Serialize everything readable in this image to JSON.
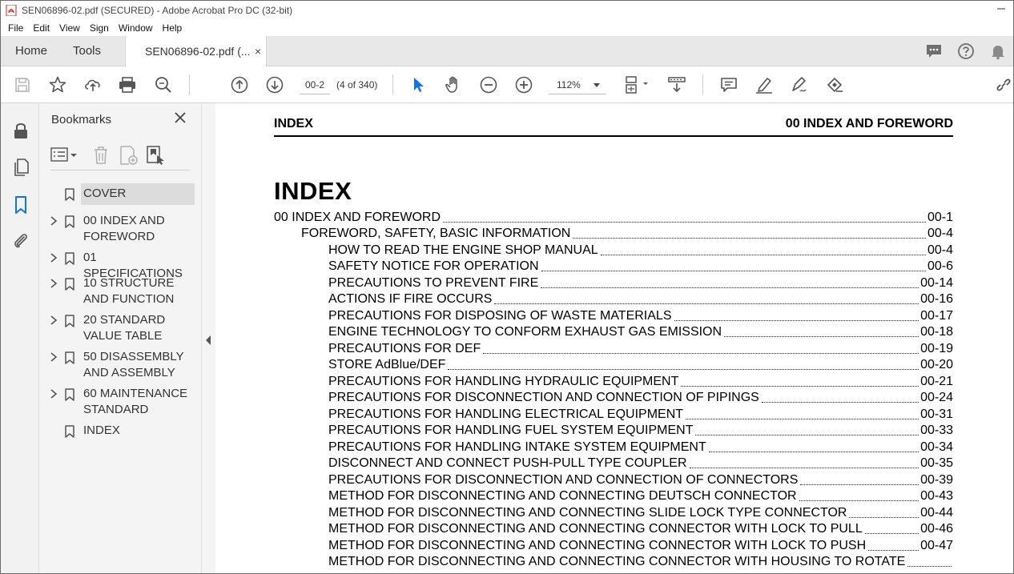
{
  "window": {
    "title": "SEN06896-02.pdf (SECURED) - Adobe Acrobat Pro DC (32-bit)"
  },
  "menu": [
    "File",
    "Edit",
    "View",
    "Sign",
    "Window",
    "Help"
  ],
  "tabs": {
    "home": "Home",
    "tools": "Tools",
    "document": "SEN06896-02.pdf (...",
    "close": "×"
  },
  "toolbar": {
    "page_value": "00-2",
    "page_count": "(4 of 340)",
    "zoom": "112%"
  },
  "bookmarks": {
    "title": "Bookmarks",
    "items": [
      {
        "label": "COVER",
        "expandable": false,
        "selected": true
      },
      {
        "label": "00 INDEX AND FOREWORD",
        "expandable": true,
        "selected": false
      },
      {
        "label": "01 SPECIFICATIONS",
        "expandable": true,
        "selected": false
      },
      {
        "label": "10 STRUCTURE AND FUNCTION",
        "expandable": true,
        "selected": false
      },
      {
        "label": "20 STANDARD VALUE TABLE",
        "expandable": true,
        "selected": false
      },
      {
        "label": "50 DISASSEMBLY AND ASSEMBLY",
        "expandable": true,
        "selected": false
      },
      {
        "label": "60 MAINTENANCE STANDARD",
        "expandable": true,
        "selected": false
      },
      {
        "label": "INDEX",
        "expandable": false,
        "selected": false
      }
    ]
  },
  "document": {
    "header_left": "INDEX",
    "header_right": "00 INDEX AND FOREWORD",
    "title": "INDEX",
    "toc": [
      {
        "level": 0,
        "text": "00 INDEX AND FOREWORD",
        "page": "00-1"
      },
      {
        "level": 1,
        "text": "FOREWORD, SAFETY, BASIC INFORMATION",
        "page": "00-4"
      },
      {
        "level": 2,
        "text": "HOW TO READ THE ENGINE SHOP MANUAL",
        "page": "00-4"
      },
      {
        "level": 2,
        "text": "SAFETY NOTICE FOR OPERATION",
        "page": "00-6"
      },
      {
        "level": 2,
        "text": "PRECAUTIONS TO PREVENT FIRE",
        "page": "00-14"
      },
      {
        "level": 2,
        "text": "ACTIONS IF FIRE OCCURS",
        "page": "00-16"
      },
      {
        "level": 2,
        "text": "PRECAUTIONS FOR DISPOSING OF WASTE MATERIALS",
        "page": "00-17"
      },
      {
        "level": 2,
        "text": "ENGINE TECHNOLOGY TO CONFORM EXHAUST GAS EMISSION",
        "page": "00-18"
      },
      {
        "level": 2,
        "text": "PRECAUTIONS FOR DEF",
        "page": "00-19"
      },
      {
        "level": 2,
        "text": "STORE AdBlue/DEF",
        "page": "00-20"
      },
      {
        "level": 2,
        "text": "PRECAUTIONS FOR HANDLING HYDRAULIC EQUIPMENT",
        "page": "00-21"
      },
      {
        "level": 2,
        "text": "PRECAUTIONS FOR DISCONNECTION AND CONNECTION OF PIPINGS",
        "page": "00-24"
      },
      {
        "level": 2,
        "text": "PRECAUTIONS FOR HANDLING ELECTRICAL EQUIPMENT",
        "page": "00-31"
      },
      {
        "level": 2,
        "text": "PRECAUTIONS FOR HANDLING FUEL SYSTEM EQUIPMENT",
        "page": "00-33"
      },
      {
        "level": 2,
        "text": "PRECAUTIONS FOR HANDLING INTAKE SYSTEM EQUIPMENT",
        "page": "00-34"
      },
      {
        "level": 2,
        "text": "DISCONNECT AND CONNECT PUSH-PULL TYPE COUPLER",
        "page": "00-35"
      },
      {
        "level": 2,
        "text": "PRECAUTIONS FOR DISCONNECTION AND CONNECTION OF CONNECTORS",
        "page": "00-39"
      },
      {
        "level": 2,
        "text": "METHOD FOR DISCONNECTING AND CONNECTING DEUTSCH CONNECTOR",
        "page": "00-43"
      },
      {
        "level": 2,
        "text": "METHOD FOR DISCONNECTING AND CONNECTING SLIDE LOCK TYPE CONNECTOR",
        "page": "00-44"
      },
      {
        "level": 2,
        "text": "METHOD FOR DISCONNECTING AND CONNECTING CONNECTOR WITH LOCK TO PULL",
        "page": "00-46"
      },
      {
        "level": 2,
        "text": "METHOD FOR DISCONNECTING AND CONNECTING CONNECTOR WITH LOCK TO PUSH",
        "page": "00-47"
      },
      {
        "level": 2,
        "text": "METHOD FOR DISCONNECTING AND CONNECTING CONNECTOR WITH HOUSING TO ROTATE",
        "page": ""
      }
    ]
  },
  "colors": {
    "acrobat_red": "#e02020",
    "select_blue": "#1473e6",
    "icon_gray": "#6e6e6e"
  }
}
